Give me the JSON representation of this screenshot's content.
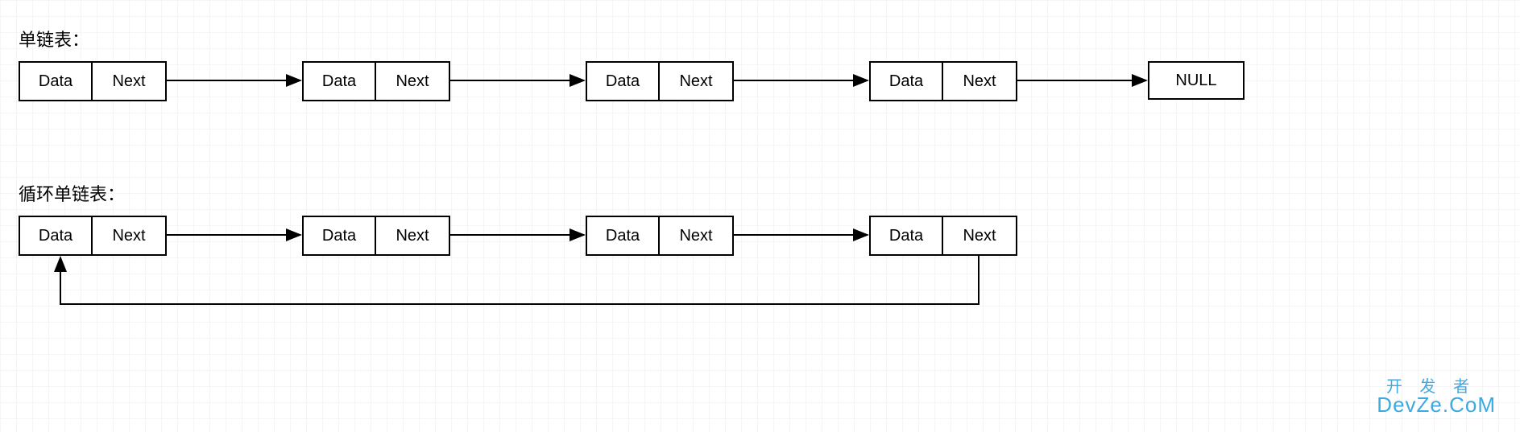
{
  "labels": {
    "singly": "单链表：",
    "circular": "循环单链表："
  },
  "node": {
    "data": "Data",
    "next": "Next"
  },
  "terminal": {
    "null": "NULL"
  },
  "watermark": {
    "top": "开 发 者",
    "bottom": "DevZe.CoM"
  },
  "diagram": {
    "singly_list": {
      "description": "singly linked list",
      "nodes": 4,
      "terminates_with": "NULL"
    },
    "circular_list": {
      "description": "circular singly linked list",
      "nodes": 4,
      "last_points_to": "first"
    }
  }
}
